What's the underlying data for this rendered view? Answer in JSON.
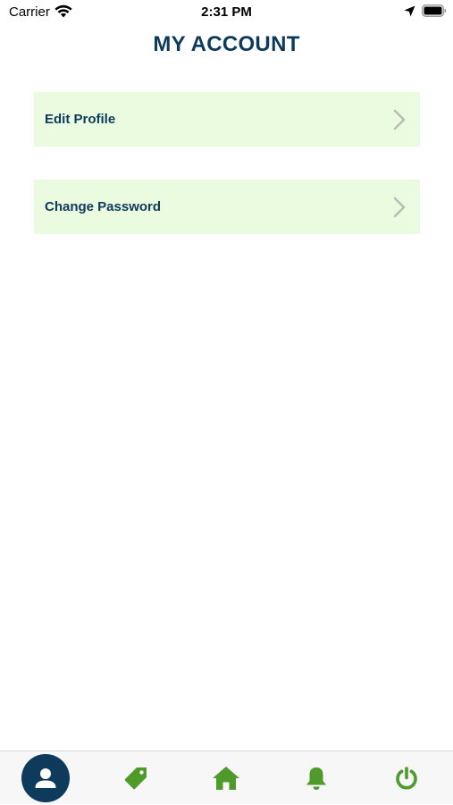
{
  "status_bar": {
    "carrier": "Carrier",
    "time": "2:31 PM"
  },
  "header": {
    "title": "MY ACCOUNT"
  },
  "menu": {
    "items": [
      {
        "label": "Edit Profile",
        "icon": "chevron-right-icon"
      },
      {
        "label": "Change Password",
        "icon": "chevron-right-icon"
      }
    ]
  },
  "tab_bar": {
    "tabs": [
      {
        "name": "account",
        "icon": "user-icon",
        "active": true
      },
      {
        "name": "tags",
        "icon": "tag-icon",
        "active": false
      },
      {
        "name": "home",
        "icon": "home-icon",
        "active": false
      },
      {
        "name": "notifications",
        "icon": "bell-icon",
        "active": false
      },
      {
        "name": "logout",
        "icon": "power-icon",
        "active": false
      }
    ]
  },
  "colors": {
    "primary": "#0e3b5c",
    "accent_green": "#4e9a2a",
    "menu_background": "#eafbdf",
    "chevron": "#b9bfb4",
    "tab_bar_background": "#f7f7f7"
  }
}
